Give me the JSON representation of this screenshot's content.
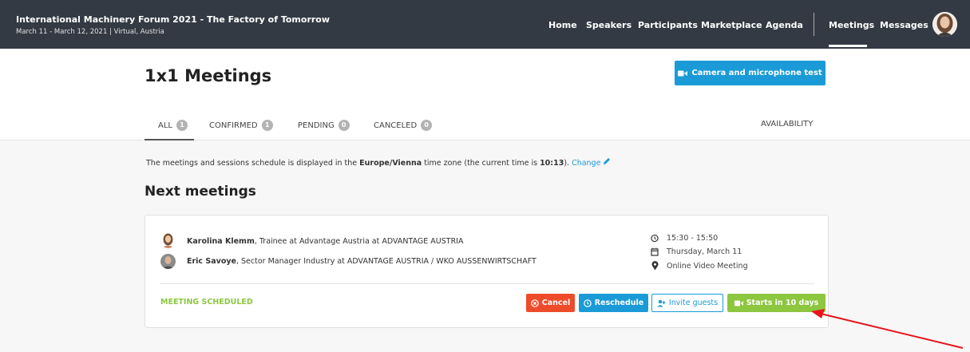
{
  "event": {
    "title": "International Machinery Forum 2021 - The Factory of Tomorrow",
    "subtitle": "March 11 - March 12, 2021 | Virtual, Austria"
  },
  "nav": {
    "home": "Home",
    "speakers": "Speakers",
    "participants": "Participants",
    "marketplace": "Marketplace",
    "agenda": "Agenda",
    "meetings": "Meetings",
    "messages": "Messages"
  },
  "page": {
    "title": "1x1 Meetings",
    "camera_button": "Camera and microphone test"
  },
  "tabs": [
    {
      "label": "ALL",
      "count": "1"
    },
    {
      "label": "CONFIRMED",
      "count": "1"
    },
    {
      "label": "PENDING",
      "count": "0"
    },
    {
      "label": "CANCELED",
      "count": "0"
    }
  ],
  "availability": "AVAILABILITY",
  "timezone": {
    "prefix": "The meetings and sessions schedule is displayed in the ",
    "zone": "Europe/Vienna",
    "middle": " time zone (the current time is ",
    "time": "10:13",
    "suffix": "). ",
    "change": "Change"
  },
  "section_title": "Next meetings",
  "meeting": {
    "participants": [
      {
        "name": "Karolina Klemm",
        "role": ", Trainee at Advantage Austria at ADVANTAGE AUSTRIA"
      },
      {
        "name": "Eric Savoye",
        "role": ", Sector Manager Industry at ADVANTAGE AUSTRIA / WKO AUSSENWIRTSCHAFT"
      }
    ],
    "time": "15:30 - 15:50",
    "date": "Thursday, March 11",
    "location": "Online Video Meeting",
    "status": "MEETING SCHEDULED",
    "buttons": {
      "cancel": "Cancel",
      "reschedule": "Reschedule",
      "invite": "Invite guests",
      "starts": "Starts in 10 days"
    }
  },
  "colors": {
    "topbar": "#343a44",
    "accent_blue": "#1a9bd7",
    "accent_green": "#8dc63f",
    "cancel_red": "#ee4b2b",
    "annotation_arrow": "#e8141c"
  },
  "icons": [
    "video-camera-icon",
    "clock-icon",
    "calendar-icon",
    "location-pin-icon",
    "pencil-icon",
    "cancel-circle-icon",
    "reschedule-clock-icon",
    "add-user-icon"
  ]
}
